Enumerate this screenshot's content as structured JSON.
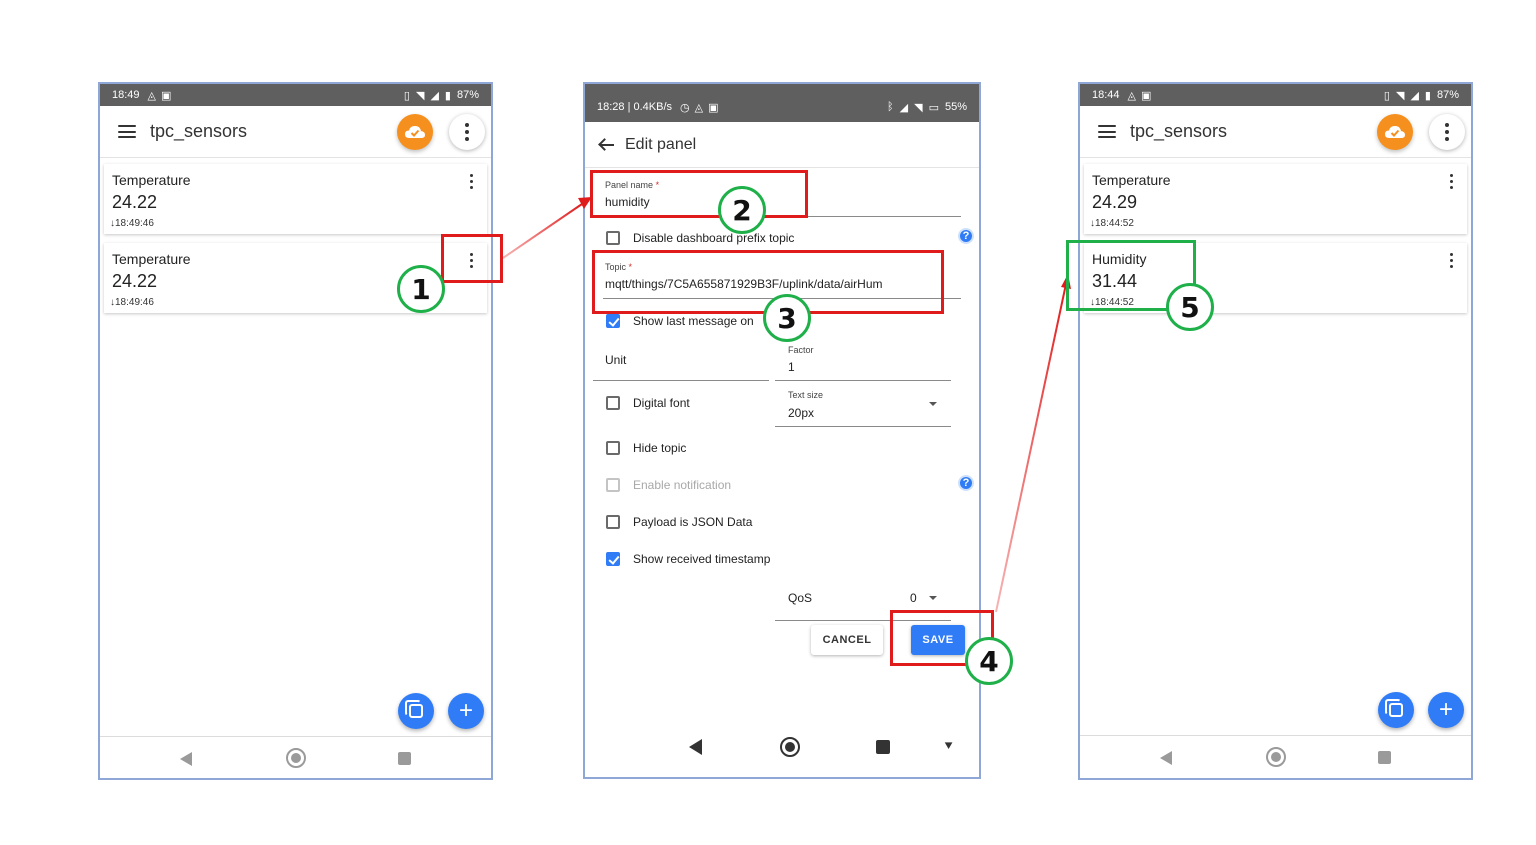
{
  "left_phone": {
    "status_time": "18:49",
    "status_battery": "87%",
    "app_title": "tpc_sensors",
    "panels": [
      {
        "name": "Temperature",
        "value": "24.22",
        "time": "18:49:46"
      },
      {
        "name": "Temperature",
        "value": "24.22",
        "time": "18:49:46"
      }
    ],
    "fab_add": "+"
  },
  "edit_phone": {
    "status_left": "18:28 | 0.4KB/s",
    "status_battery": "55%",
    "title": "Edit panel",
    "panel_name_label": "Panel name",
    "panel_name_value": "humidity",
    "disable_prefix_label": "Disable dashboard prefix topic",
    "topic_label": "Topic",
    "topic_value": "mqtt/things/7C5A655871929B3F/uplink/data/airHum",
    "show_last_message_label": "Show last message on",
    "unit_label": "Unit",
    "factor_label": "Factor",
    "factor_value": "1",
    "digital_font_label": "Digital font",
    "text_size_label": "Text size",
    "text_size_value": "20px",
    "hide_topic_label": "Hide topic",
    "enable_notification_label": "Enable notification",
    "payload_json_label": "Payload is JSON Data",
    "show_timestamp_label": "Show received timestamp",
    "qos_label": "QoS",
    "qos_value": "0",
    "cancel_label": "CANCEL",
    "save_label": "SAVE",
    "required_mark": "*",
    "help_mark": "?"
  },
  "right_phone": {
    "status_time": "18:44",
    "status_battery": "87%",
    "app_title": "tpc_sensors",
    "panels": [
      {
        "name": "Temperature",
        "value": "24.29",
        "time": "18:44:52"
      },
      {
        "name": "Humidity",
        "value": "31.44",
        "time": "18:44:52"
      }
    ],
    "fab_add": "+"
  },
  "steps": [
    "1",
    "2",
    "3",
    "4",
    "5"
  ],
  "colors": {
    "annotation_red": "#e01b1b",
    "annotation_green": "#1fb04a",
    "accent_blue": "#2f7cf6",
    "cloud_orange": "#f5901e"
  }
}
